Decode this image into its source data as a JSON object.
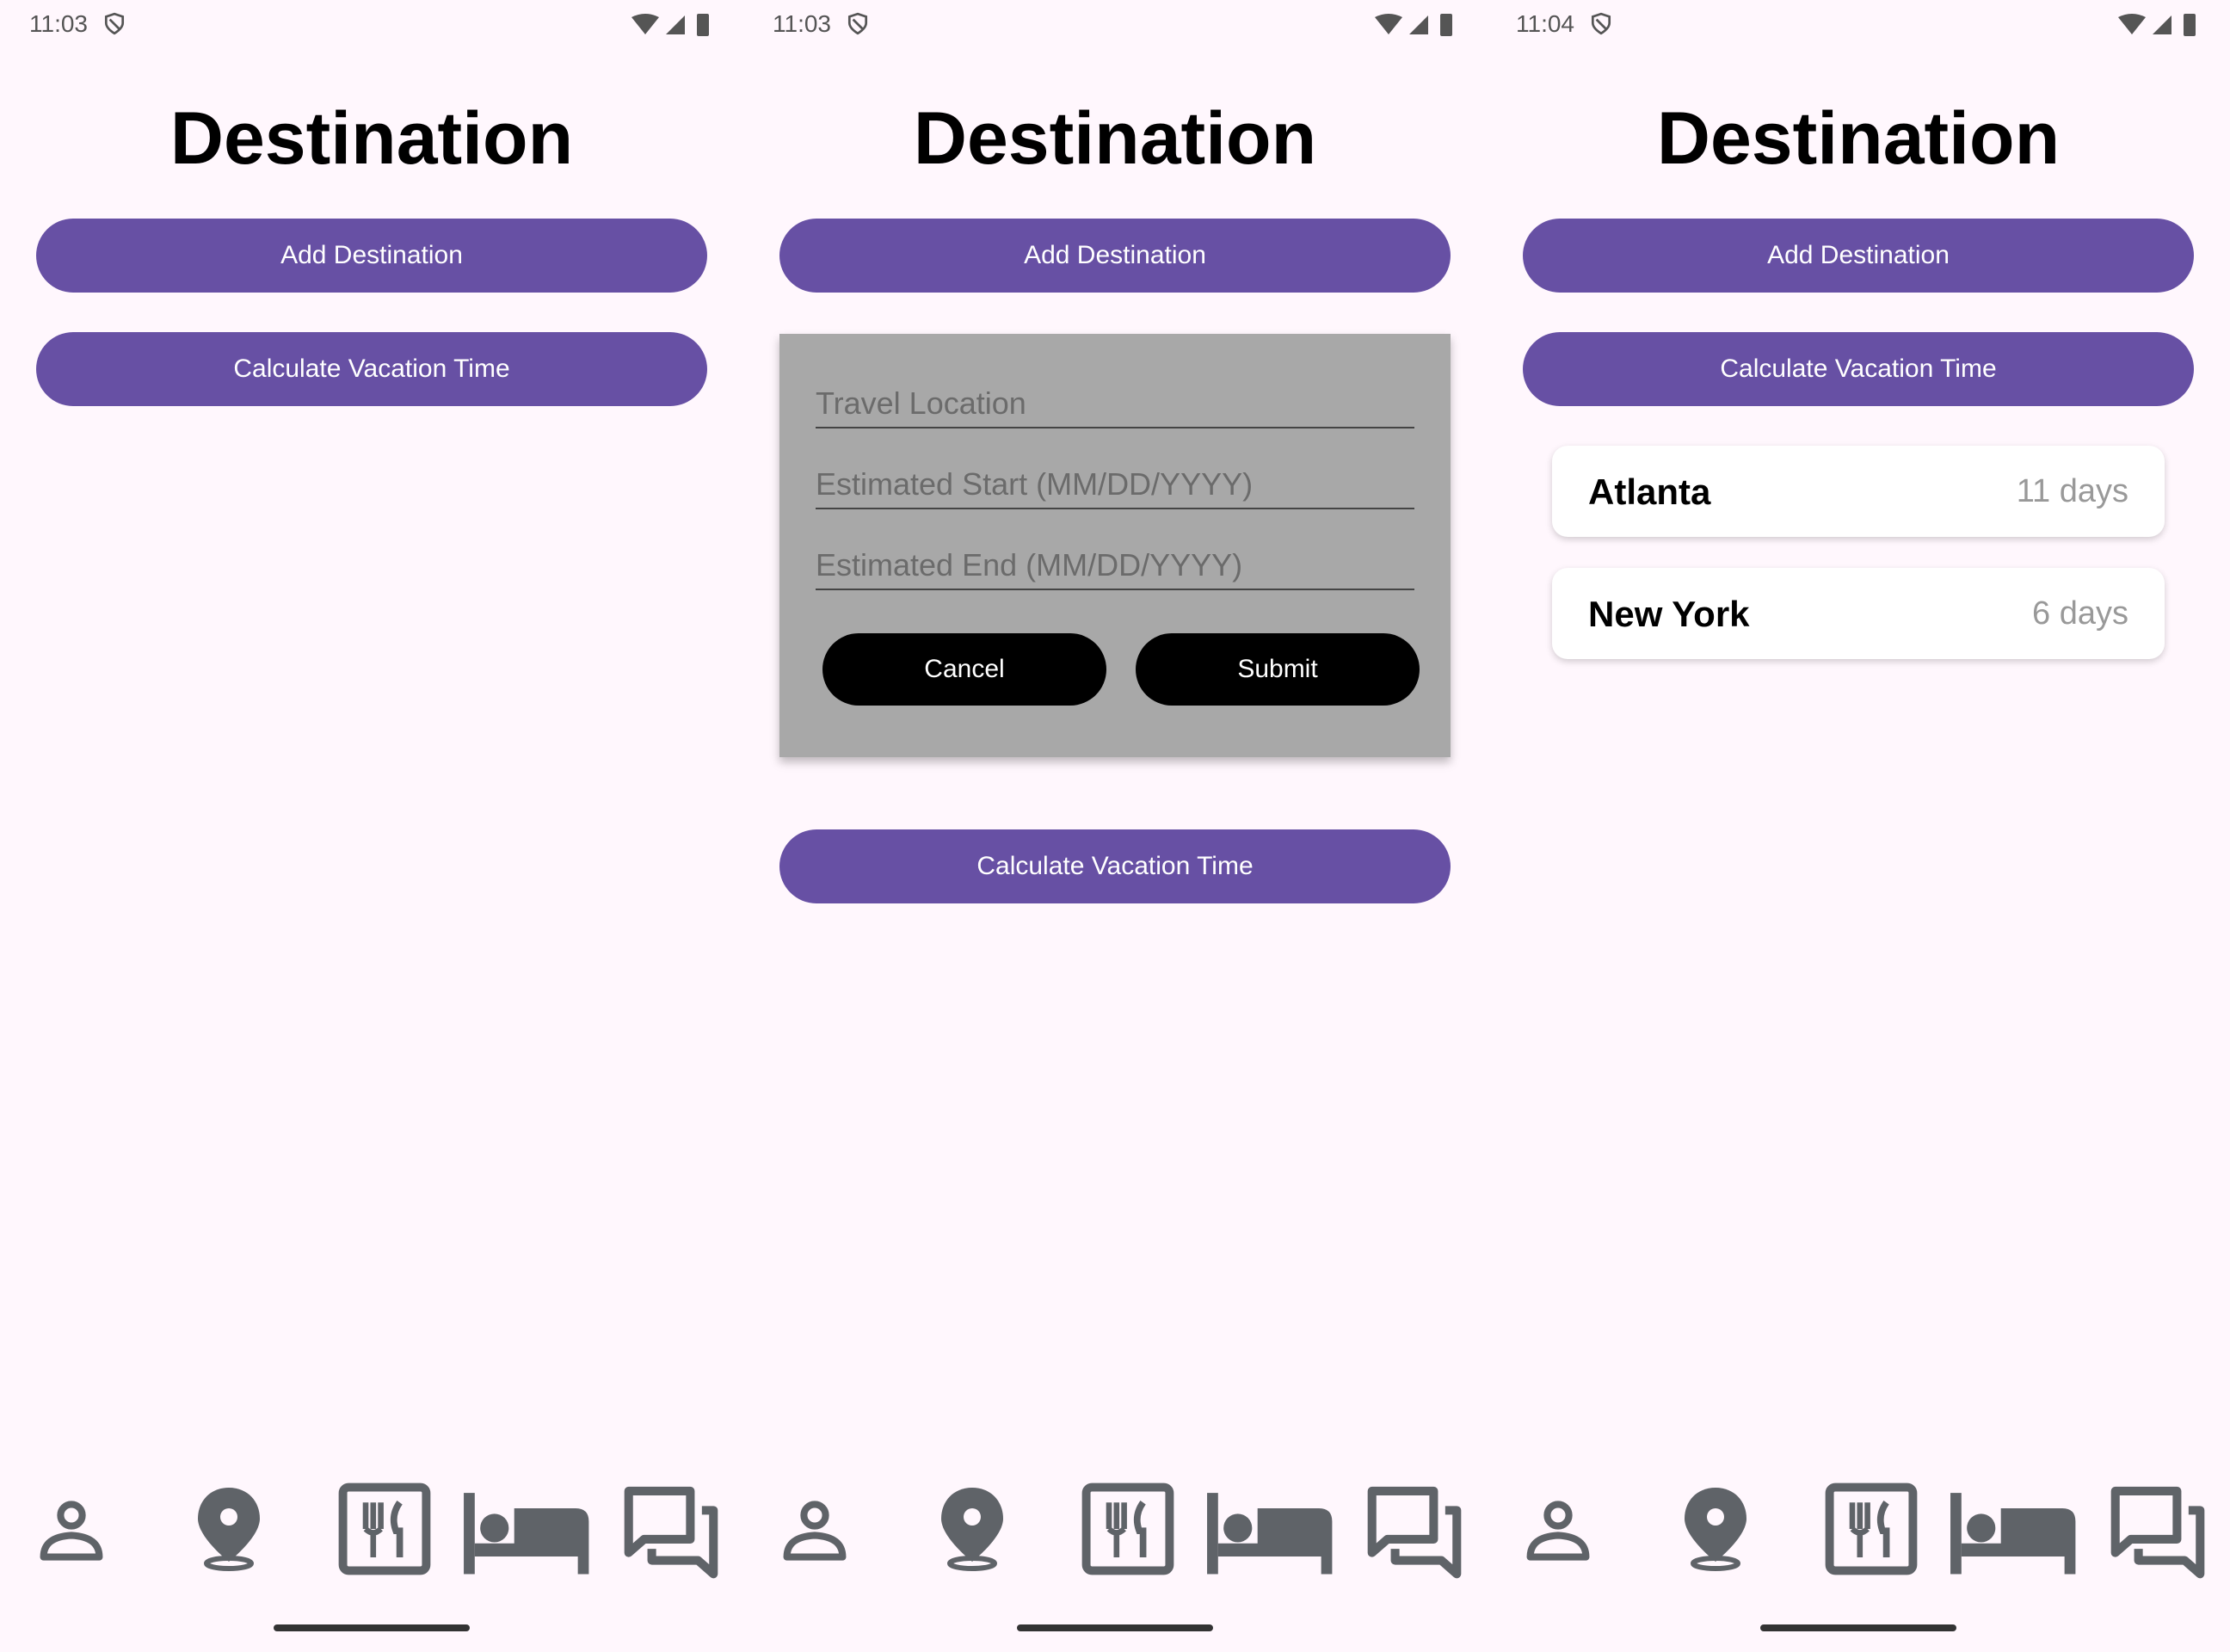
{
  "colors": {
    "accent": "#6750a4",
    "background": "#fff7fd",
    "dialog": "#a8a8a8",
    "icon": "#5f6368"
  },
  "screens": [
    {
      "status": {
        "time": "11:03"
      },
      "title": "Destination",
      "add_label": "Add Destination",
      "calc_label": "Calculate Vacation Time"
    },
    {
      "status": {
        "time": "11:03"
      },
      "title": "Destination",
      "add_label": "Add Destination",
      "calc_label": "Calculate Vacation Time",
      "dialog": {
        "location_placeholder": "Travel Location",
        "start_placeholder": "Estimated Start (MM/DD/YYYY)",
        "end_placeholder": "Estimated End (MM/DD/YYYY)",
        "cancel_label": "Cancel",
        "submit_label": "Submit"
      }
    },
    {
      "status": {
        "time": "11:04"
      },
      "title": "Destination",
      "add_label": "Add Destination",
      "calc_label": "Calculate Vacation Time",
      "destinations": [
        {
          "city": "Atlanta",
          "duration": "11 days"
        },
        {
          "city": "New York",
          "duration": "6 days"
        }
      ]
    }
  ],
  "nav_icons": [
    "person-icon",
    "location-pin-icon",
    "restaurant-icon",
    "hotel-bed-icon",
    "chat-icon"
  ]
}
